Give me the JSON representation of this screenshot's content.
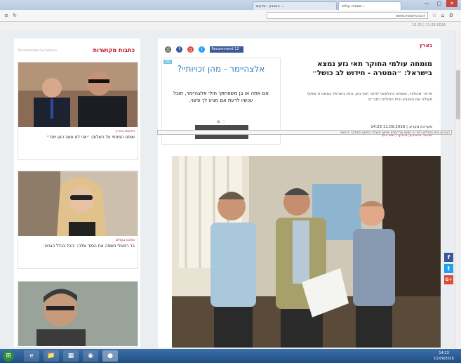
{
  "browser": {
    "tabs": [
      {
        "label": "הטכניון - מדעים ..."
      },
      {
        "label": "מומחה עולמי..."
      }
    ],
    "url": "www.maariv.co.il",
    "window_controls": [
      "—",
      "▢",
      "✕"
    ],
    "top_strip": "15:31 | 11.09.2016"
  },
  "sidebar": {
    "title": "כתבות מקושרות",
    "sponsored": "Recommended by Outbrain",
    "cards": [
      {
        "category": "חדשות בארץ",
        "caption": "שופט המחוזי על השלום: ״אני לא אשב כאן יותר״"
      },
      {
        "category": "סלבס בעולם",
        "caption": "בר רפאלי חשפה את הסוד שלה: ׳הכל בגלל הגנים׳"
      },
      {
        "category": "",
        "caption": ""
      }
    ]
  },
  "article": {
    "breadcrumb": "בארץ",
    "share": {
      "facebook_label": "Recommend 12"
    },
    "headline": "מומחה עולמי החוקר תאי גזע נמצא בישראל: ״המטרה - חידוש לב כושל״",
    "lead": "פרופ׳ מהולנד, מומחה בינלאומי לחקר תאי גזע, נחת בישראל במסגרת שיתוף פעולה עם הטכניון ובית החולים רמב״ם",
    "byline": "מערכת מעריב | 11.09.2016 14:23",
    "tags": "תגיות: הטכניון, מחקר, תאי גזע",
    "photo_caption": "הטכניון ובית החולים רמב״ם חתמו על הסכם שיתוף פעולה בתחום המחקר הרפואי"
  },
  "ad": {
    "badge": "AD",
    "title": "אלצהיימר - מהן זכויותיי?",
    "text": "אם אתה או בן משפחתך חולי אלצהיימר, תוכל עכשיו לדעת אם מגיע לך פיצוי.",
    "dots": "● ○",
    "button": "‹"
  },
  "social": [
    {
      "name": "facebook",
      "glyph": "f",
      "color": "#3b5998"
    },
    {
      "name": "twitter",
      "glyph": "t",
      "color": "#1da1f2"
    },
    {
      "name": "google-plus",
      "glyph": "G+",
      "color": "#dd4b39"
    }
  ],
  "taskbar": {
    "buttons": [
      "⊞",
      "e",
      "📁",
      "▦",
      "◉",
      "●"
    ],
    "clock_time": "14:23",
    "clock_date": "11/09/2016"
  }
}
